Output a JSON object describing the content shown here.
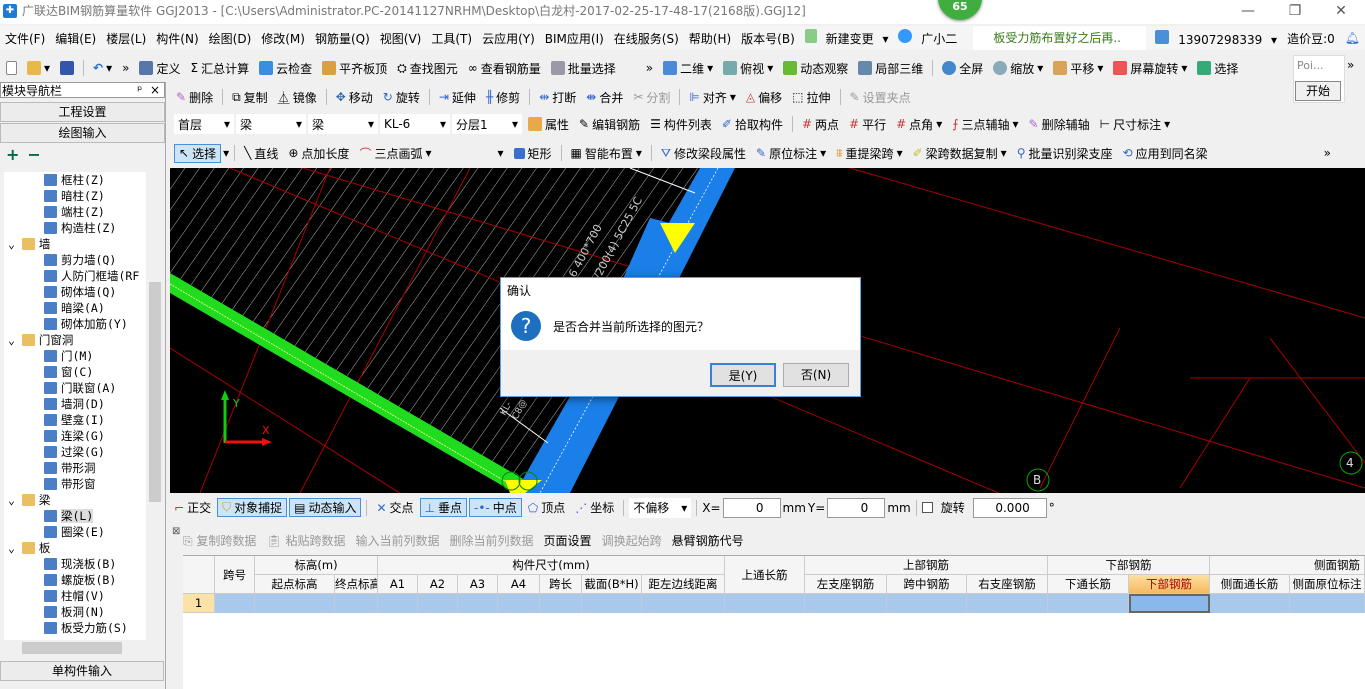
{
  "window": {
    "title": "广联达BIM钢筋算量软件 GGJ2013 - [C:\\Users\\Administrator.PC-20141127NRHM\\Desktop\\白龙村-2017-02-25-17-48-17(2168版).GGJ12]",
    "badge": "65",
    "min": "—",
    "restore": "❐",
    "close": "✕"
  },
  "menu": [
    "文件(F)",
    "编辑(E)",
    "楼层(L)",
    "构件(N)",
    "绘图(D)",
    "修改(M)",
    "钢筋量(Q)",
    "视图(V)",
    "工具(T)",
    "云应用(Y)",
    "BIM应用(I)",
    "在线服务(S)",
    "帮助(H)",
    "版本号(B)",
    "新建变更",
    "广小二"
  ],
  "notice": "板受力筋布置好之后再..",
  "account": {
    "phone": "13907298339",
    "beans": "造价豆:0"
  },
  "toolbar1": [
    "定义",
    "汇总计算",
    "云检查",
    "平齐板顶",
    "查找图元",
    "查看钢筋量",
    "批量选择",
    "二维",
    "俯视",
    "动态观察",
    "局部三维",
    "全屏",
    "缩放",
    "平移",
    "屏幕旋转",
    "选择"
  ],
  "toolbar1_more": "»",
  "popup": {
    "title": "Poi...",
    "start": "开始"
  },
  "nav": {
    "title": "模块导航栏",
    "pin": "ᵖ",
    "close": "×",
    "btn_settings": "工程设置",
    "btn_draw": "绘图输入",
    "btn_single": "单构件输入",
    "expand": "+",
    "collapse": "−"
  },
  "tree": [
    {
      "label": "框柱(Z)",
      "level": 2
    },
    {
      "label": "暗柱(Z)",
      "level": 2
    },
    {
      "label": "端柱(Z)",
      "level": 2
    },
    {
      "label": "构造柱(Z)",
      "level": 2
    },
    {
      "label": "墙",
      "level": 1
    },
    {
      "label": "剪力墙(Q)",
      "level": 2
    },
    {
      "label": "人防门框墙(RF",
      "level": 2
    },
    {
      "label": "砌体墙(Q)",
      "level": 2
    },
    {
      "label": "暗梁(A)",
      "level": 2
    },
    {
      "label": "砌体加筋(Y)",
      "level": 2
    },
    {
      "label": "门窗洞",
      "level": 1
    },
    {
      "label": "门(M)",
      "level": 2
    },
    {
      "label": "窗(C)",
      "level": 2
    },
    {
      "label": "门联窗(A)",
      "level": 2
    },
    {
      "label": "墙洞(D)",
      "level": 2
    },
    {
      "label": "壁龛(I)",
      "level": 2
    },
    {
      "label": "连梁(G)",
      "level": 2
    },
    {
      "label": "过梁(G)",
      "level": 2
    },
    {
      "label": "带形洞",
      "level": 2
    },
    {
      "label": "带形窗",
      "level": 2
    },
    {
      "label": "梁",
      "level": 1
    },
    {
      "label": "梁(L)",
      "level": 2,
      "selected": true
    },
    {
      "label": "圈梁(E)",
      "level": 2
    },
    {
      "label": "板",
      "level": 1
    },
    {
      "label": "现浇板(B)",
      "level": 2
    },
    {
      "label": "螺旋板(B)",
      "level": 2
    },
    {
      "label": "柱帽(V)",
      "level": 2
    },
    {
      "label": "板洞(N)",
      "level": 2
    },
    {
      "label": "板受力筋(S)",
      "level": 2
    }
  ],
  "toolbar2": [
    "删除",
    "复制",
    "镜像",
    "移动",
    "旋转",
    "延伸",
    "修剪",
    "打断",
    "合并",
    "分割",
    "对齐",
    "偏移",
    "拉伸",
    "设置夹点"
  ],
  "selectors": {
    "floor": "首层",
    "type1": "梁",
    "type2": "梁",
    "component": "KL-6",
    "layer": "分层1"
  },
  "toolbar3": [
    "属性",
    "编辑钢筋",
    "构件列表",
    "拾取构件",
    "两点",
    "平行",
    "点角",
    "三点辅轴",
    "删除辅轴",
    "尺寸标注"
  ],
  "toolbar4": [
    "选择",
    "直线",
    "点加长度",
    "三点画弧",
    "",
    "矩形",
    "智能布置",
    "修改梁段属性",
    "原位标注",
    "重提梁跨",
    "梁跨数据复制",
    "批量识别梁支座",
    "应用到同名梁"
  ],
  "canvas": {
    "axis_x": "X",
    "axis_y": "Y",
    "grid_b": "B",
    "grid_4": "4",
    "label1": "6 400*700",
    "label2": "100/200(4) 5C25 5C",
    "label3": "KL-",
    "label4": "C8@"
  },
  "dialog": {
    "title": "确认",
    "message": "是否合并当前所选择的图元？",
    "yes": "是(Y)",
    "no": "否(N)"
  },
  "snap": {
    "ortho": "正交",
    "osnap": "对象捕捉",
    "dyn": "动态输入",
    "intersect": "交点",
    "perp": "垂点",
    "mid": "中点",
    "vertex": "顶点",
    "coord": "坐标",
    "offset": "不偏移",
    "x_label": "X=",
    "x": "0",
    "unit": "mm",
    "y_label": "Y=",
    "y": "0",
    "rotate": "旋转",
    "angle": "0.000",
    "deg": "°"
  },
  "gridtoolbar": {
    "copy": "复制跨数据",
    "paste": "粘贴跨数据",
    "input_col": "输入当前列数据",
    "del_col": "删除当前列数据",
    "page": "页面设置",
    "swap": "调换起始跨",
    "cantilever": "悬臂钢筋代号"
  },
  "table": {
    "groups": {
      "span": "跨号",
      "elev": "标高(m)",
      "size": "构件尺寸(mm)",
      "top_through": "上通长筋",
      "top": "上部钢筋",
      "bottom": "下部钢筋",
      "side": "侧面钢筋"
    },
    "columns": [
      "起点标高",
      "终点标高",
      "A1",
      "A2",
      "A3",
      "A4",
      "跨长",
      "截面(B*H)",
      "距左边线距离",
      "左支座钢筋",
      "跨中钢筋",
      "右支座钢筋",
      "下通长筋",
      "下部钢筋",
      "侧面通长筋",
      "侧面原位标注"
    ],
    "rows": [
      {
        "index": "1"
      }
    ]
  }
}
